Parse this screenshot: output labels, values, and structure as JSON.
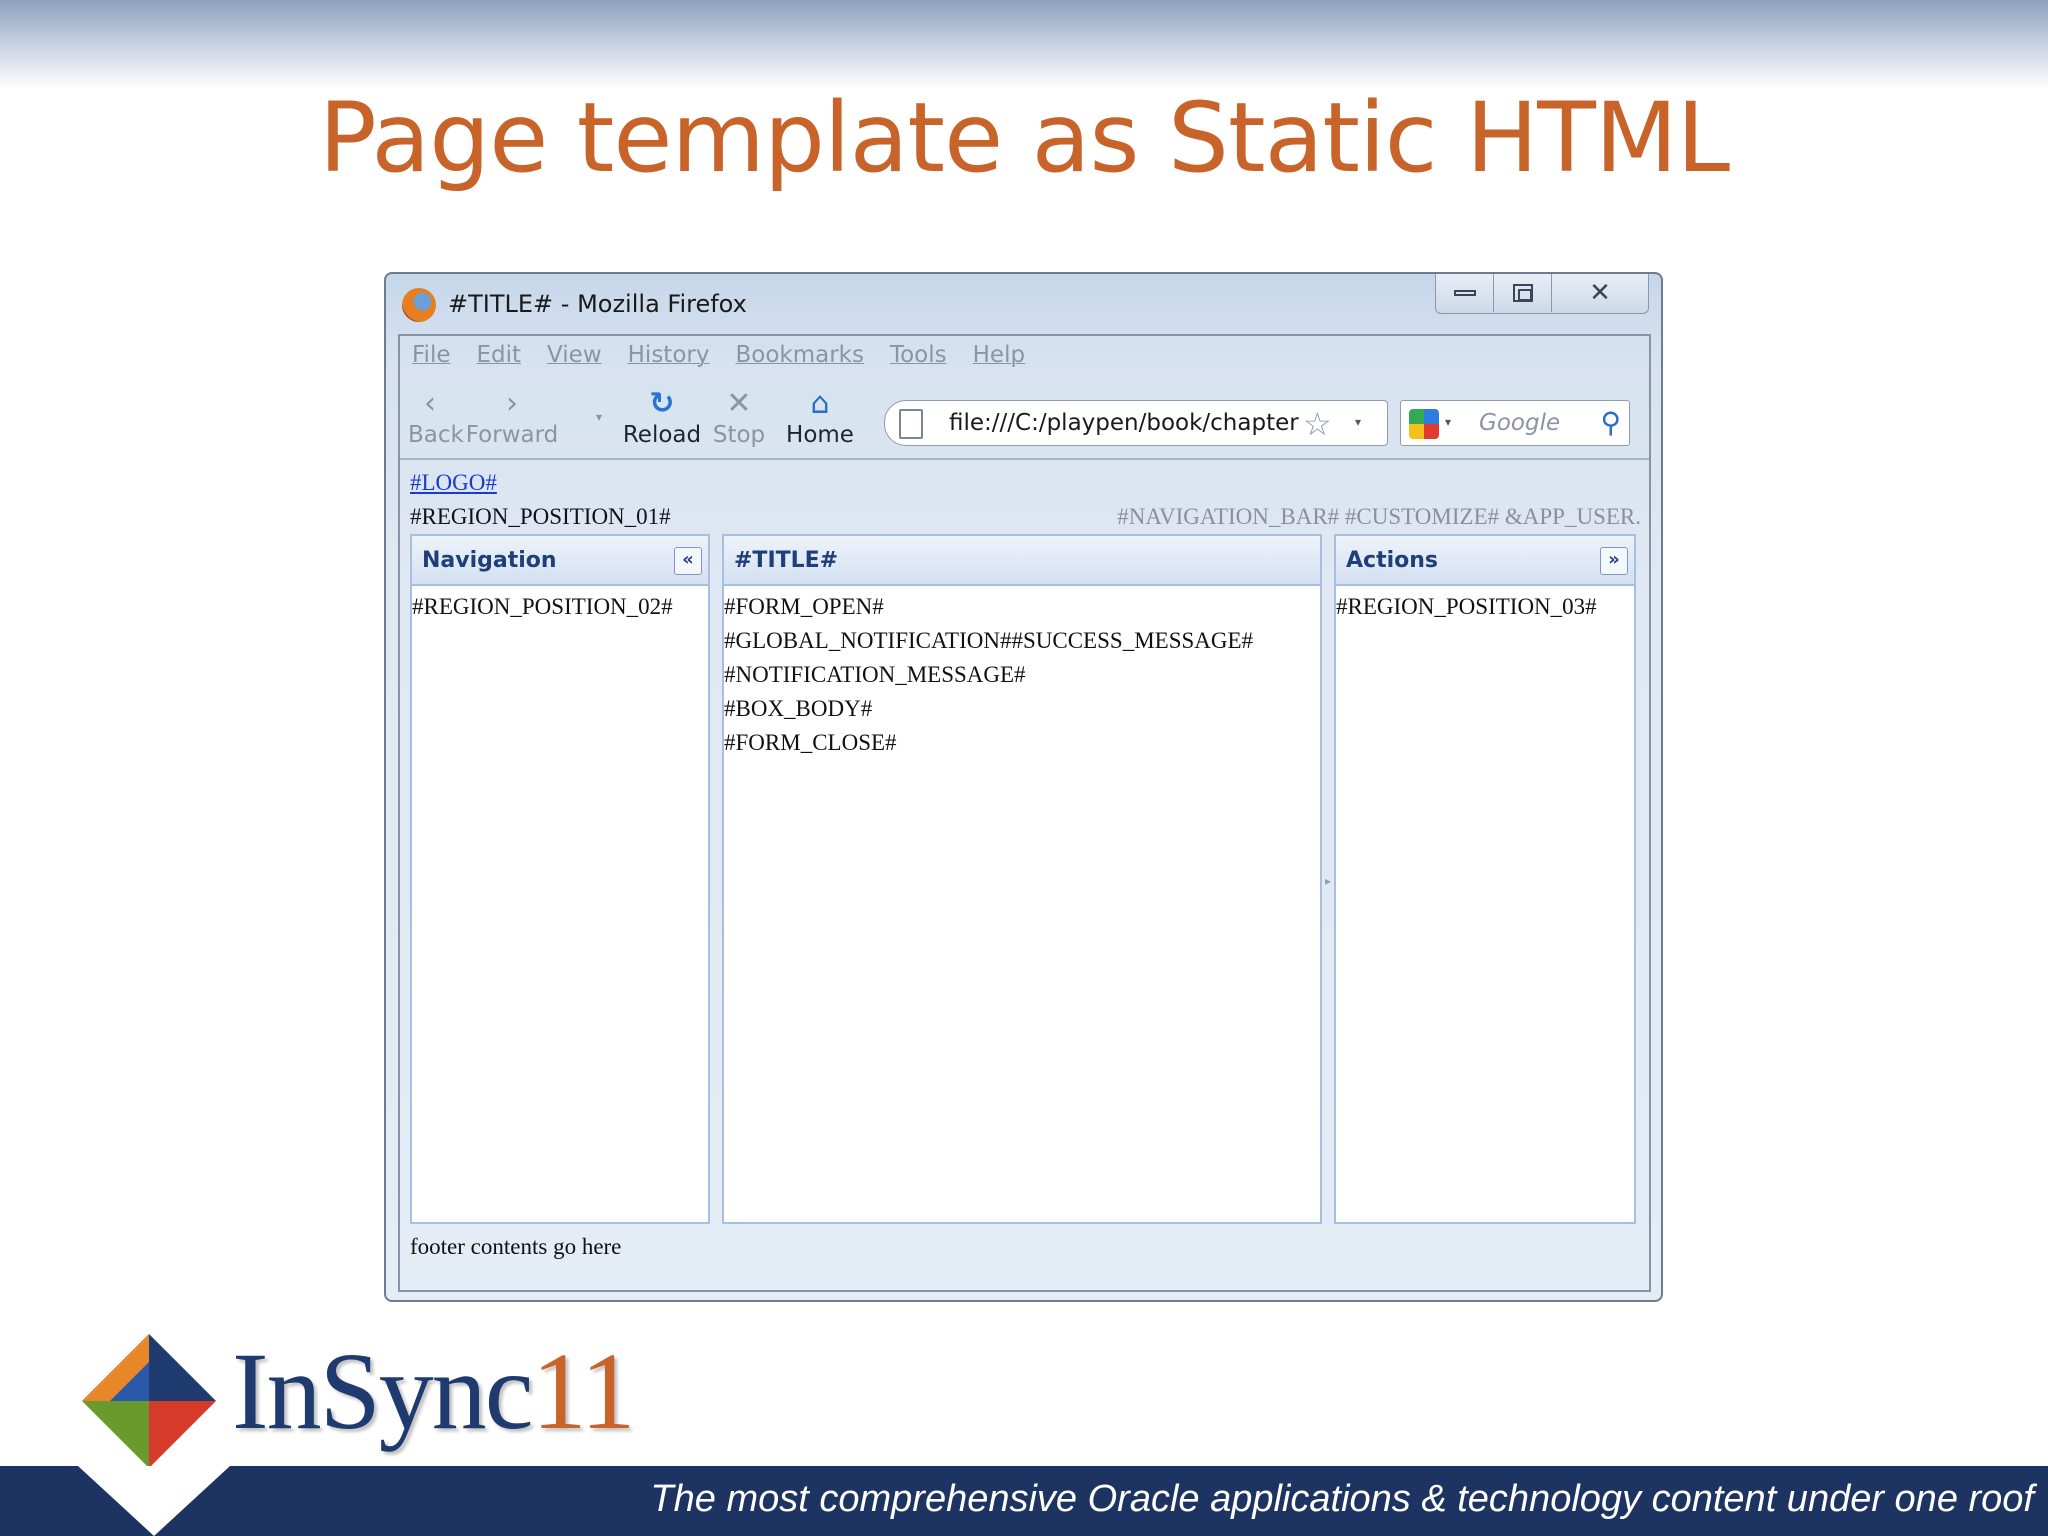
{
  "slide": {
    "title": "Page template as Static HTML",
    "brand_main": "InSync",
    "brand_num": "11",
    "tagline": "The most comprehensive Oracle applications & technology content under one roof"
  },
  "browser": {
    "window_title": "#TITLE# - Mozilla Firefox",
    "menu": [
      "File",
      "Edit",
      "View",
      "History",
      "Bookmarks",
      "Tools",
      "Help"
    ],
    "nav_buttons": {
      "back": "Back",
      "forward": "Forward",
      "reload": "Reload",
      "stop": "Stop",
      "home": "Home"
    },
    "url": "file:///C:/playpen/book/chapter",
    "search_placeholder": "Google"
  },
  "page": {
    "logo": "#LOGO#",
    "region01": "#REGION_POSITION_01#",
    "navbar_text": "#NAVIGATION_BAR# #CUSTOMIZE# &APP_USER.",
    "nav_panel": {
      "title": "Navigation",
      "toggle": "«",
      "body": [
        "#REGION_POSITION_02#"
      ]
    },
    "main_panel": {
      "title": "#TITLE#",
      "body": [
        "#FORM_OPEN#",
        "#GLOBAL_NOTIFICATION##SUCCESS_MESSAGE#",
        "#NOTIFICATION_MESSAGE#",
        "#BOX_BODY#",
        "#FORM_CLOSE#"
      ]
    },
    "actions_panel": {
      "title": "Actions",
      "toggle": "»",
      "body": [
        "#REGION_POSITION_03#"
      ]
    },
    "footer": "footer contents go here"
  },
  "colors": {
    "title": "#c8632a",
    "panel_header_text": "#1f3f7a",
    "band": "#1d3463"
  }
}
